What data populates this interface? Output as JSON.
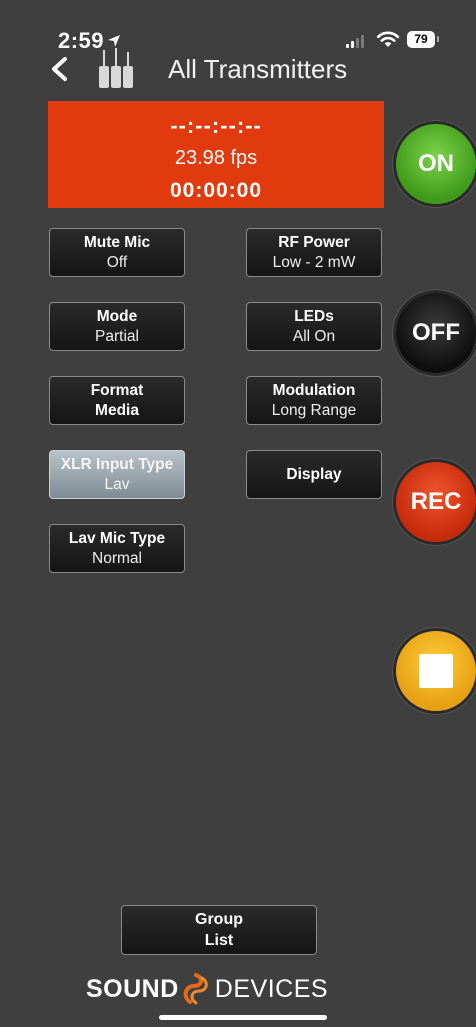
{
  "status_bar": {
    "time": "2:59",
    "battery": "79"
  },
  "header": {
    "title": "All Transmitters"
  },
  "timecode": {
    "dashes": "--:--:--:--",
    "fps": "23.98 fps",
    "time": "00:00:00",
    "panel_color": "#e03a0e"
  },
  "settings": {
    "mute_mic": {
      "label": "Mute Mic",
      "value": "Off"
    },
    "rf_power": {
      "label": "RF Power",
      "value": "Low - 2 mW"
    },
    "mode": {
      "label": "Mode",
      "value": "Partial"
    },
    "leds": {
      "label": "LEDs",
      "value": "All On"
    },
    "format_media": {
      "label": "Format",
      "value": "Media"
    },
    "modulation": {
      "label": "Modulation",
      "value": "Long Range"
    },
    "xlr_input_type": {
      "label": "XLR Input Type",
      "value": "Lav"
    },
    "display": {
      "label": "Display"
    },
    "lav_mic_type": {
      "label": "Lav Mic Type",
      "value": "Normal"
    }
  },
  "controls": {
    "on_label": "ON",
    "off_label": "OFF",
    "rec_label": "REC"
  },
  "group_list": {
    "line1": "Group",
    "line2": "List"
  },
  "logo": {
    "left": "SOUND",
    "right": "DEVICES"
  },
  "colors": {
    "background": "#3f3f3f",
    "on": "#4fae22",
    "rec": "#d8340f",
    "stop": "#f2b21e",
    "selected_button": "#9aa6ad"
  }
}
